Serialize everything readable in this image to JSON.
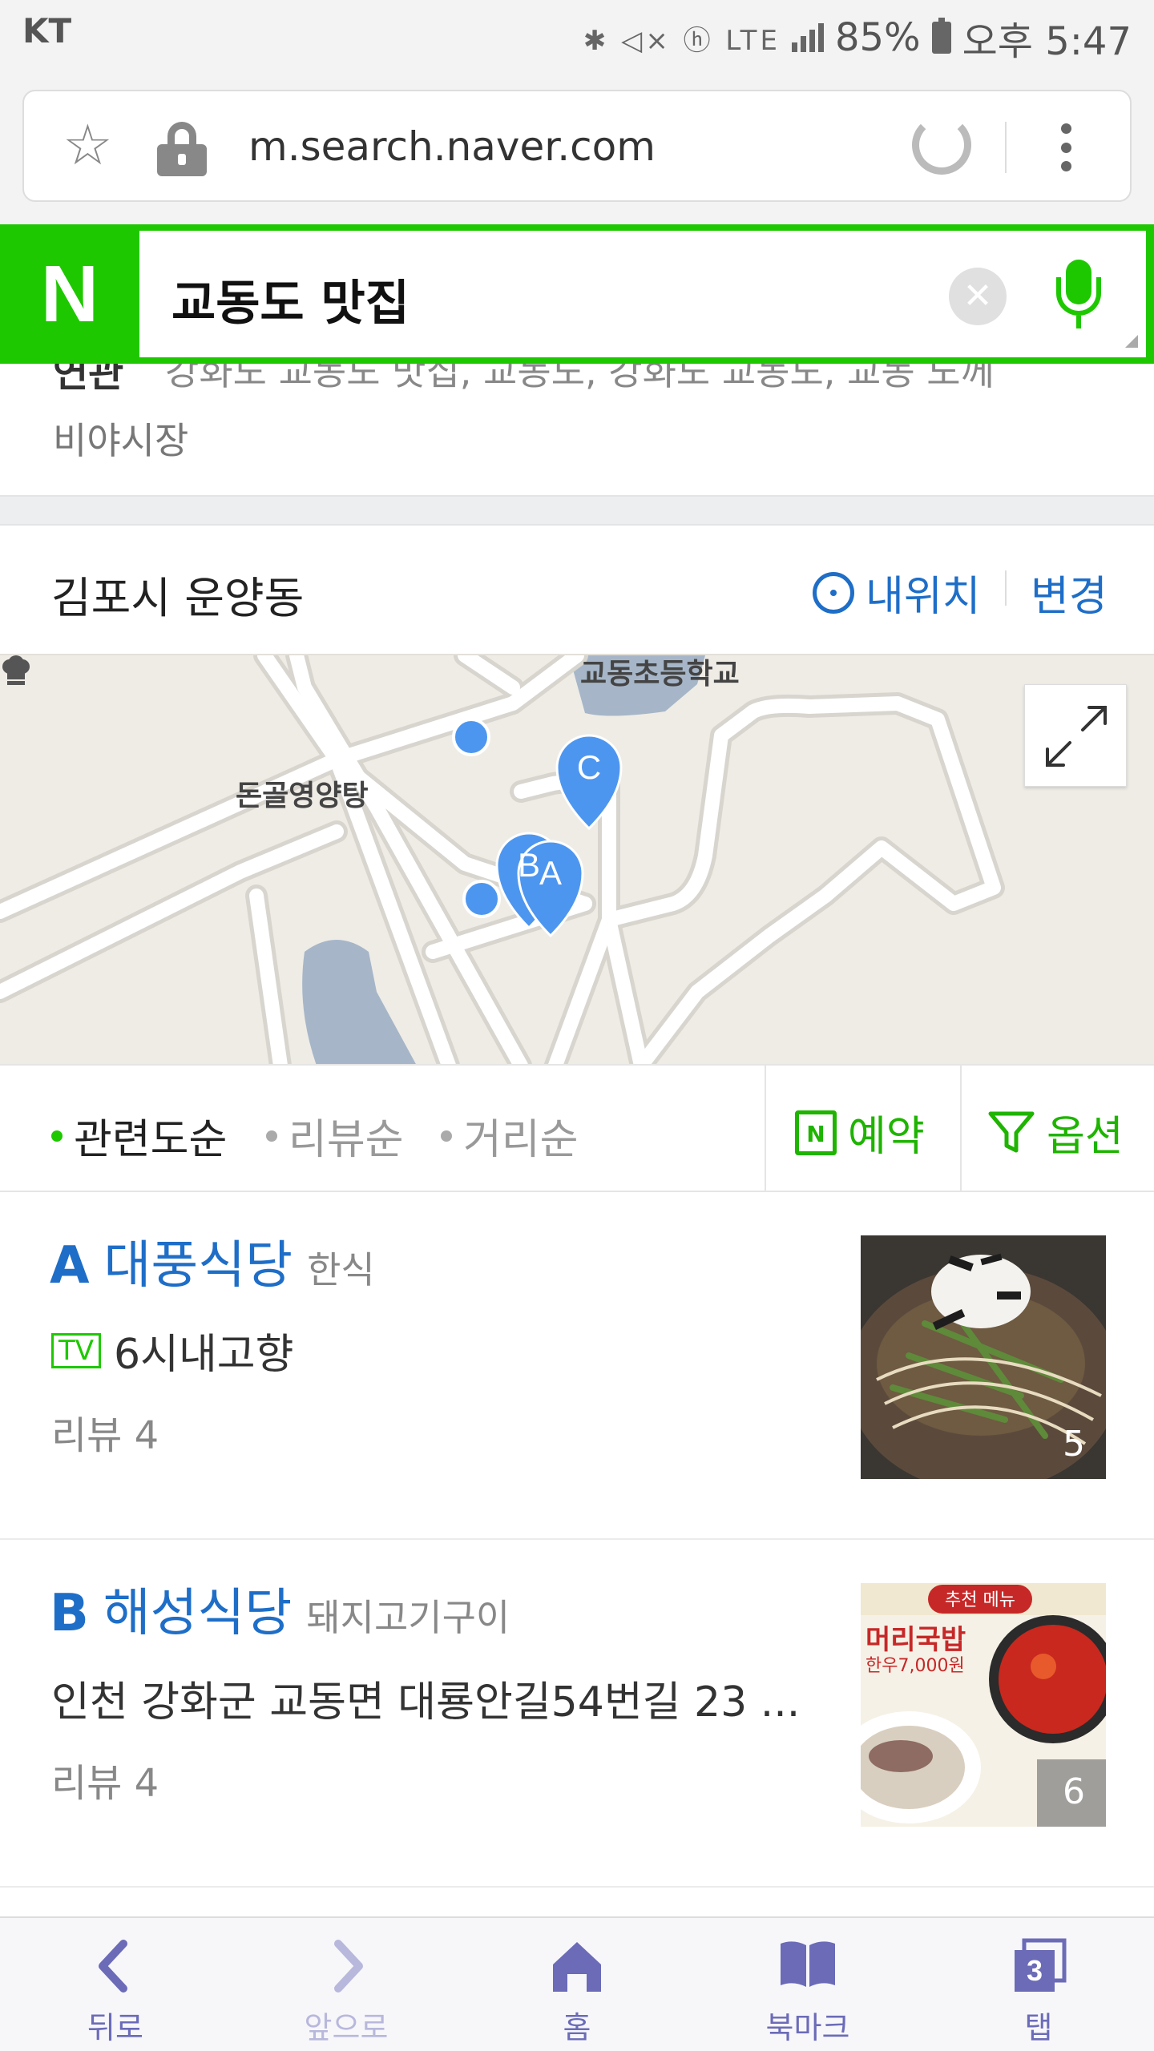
{
  "status_bar": {
    "carrier": "KT",
    "battery": "85%",
    "time": "오후 5:47"
  },
  "browser": {
    "url": "m.search.naver.com"
  },
  "search": {
    "logo": "N",
    "query": "교동도 맛집"
  },
  "related": {
    "label": "연관",
    "items": "강화도 교동도 맛집, 교동도, 강화도 교동도, 교동 노께",
    "line2": "비야시장"
  },
  "location": {
    "title": "김포시 운양동",
    "my_location": "내위치",
    "change": "변경"
  },
  "map": {
    "labels": {
      "school": "교동초등학교",
      "restaurant": "돈골영양탕"
    },
    "markers": [
      "A",
      "B",
      "C"
    ]
  },
  "sort": {
    "options": [
      {
        "label": "관련도순",
        "active": true
      },
      {
        "label": "리뷰순",
        "active": false
      },
      {
        "label": "거리순",
        "active": false
      }
    ],
    "reserve": "예약",
    "option": "옵션"
  },
  "results": [
    {
      "letter": "A",
      "name": "대풍식당",
      "category": "한식",
      "badge": "TV",
      "detail": "6시내고향",
      "review": "리뷰 4",
      "photo_count": "5"
    },
    {
      "letter": "B",
      "name": "해성식당",
      "category": "돼지고기구이",
      "badge": "",
      "detail": "인천 강화군 교동면 대룡안길54번길 23 ...",
      "review": "리뷰 4",
      "photo_count": "6",
      "thumb_text": {
        "banner": "추천 메뉴",
        "menu": "머리국밥",
        "price": "한우7,000원"
      }
    }
  ],
  "bottom_nav": [
    {
      "label": "뒤로",
      "icon": "back-icon",
      "enabled": true
    },
    {
      "label": "앞으로",
      "icon": "forward-icon",
      "enabled": false
    },
    {
      "label": "홈",
      "icon": "home-icon",
      "enabled": true
    },
    {
      "label": "북마크",
      "icon": "bookmark-icon",
      "enabled": true
    },
    {
      "label": "탭",
      "icon": "tabs-icon",
      "enabled": true,
      "count": "3"
    }
  ],
  "colors": {
    "naver_green": "#1ec800",
    "link_blue": "#1e6ec8",
    "marker_blue": "#4d96f0",
    "nav_purple": "#6b6bb8"
  }
}
